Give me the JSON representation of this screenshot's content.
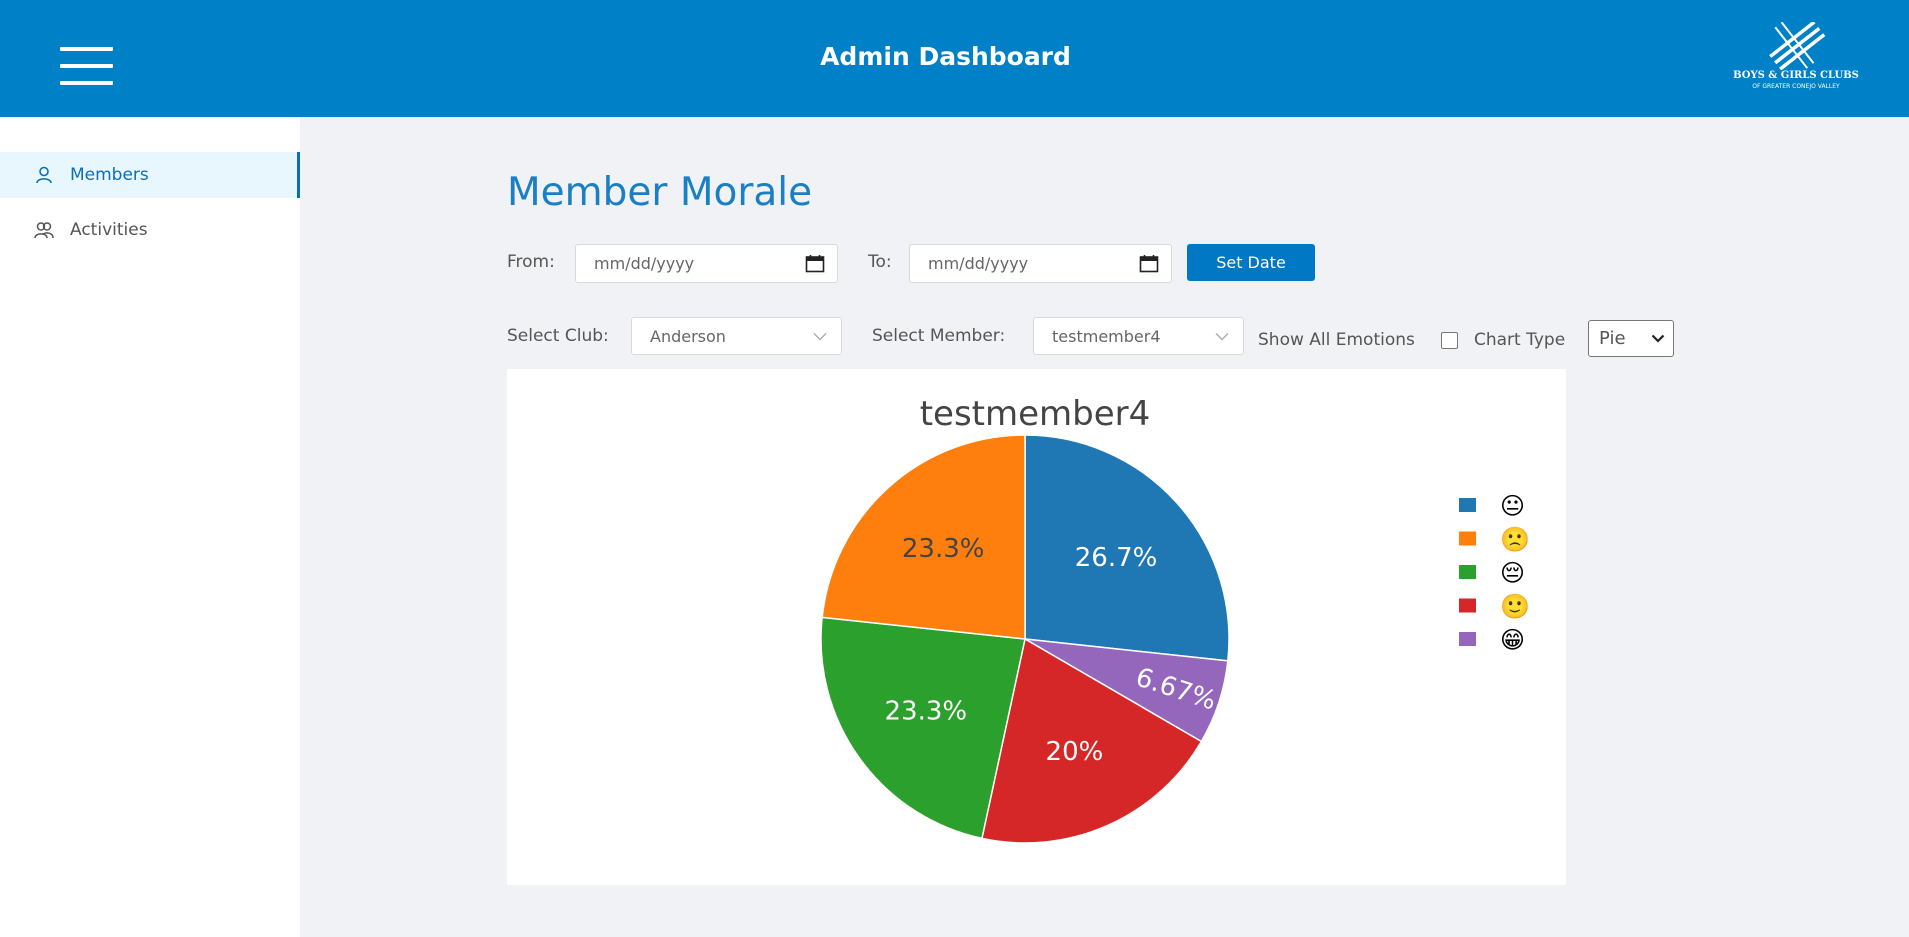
{
  "header": {
    "title": "Admin Dashboard",
    "logo_text": "BOYS & GIRLS CLUBS",
    "logo_subtext": "OF GREATER CONEJO VALLEY"
  },
  "sidebar": {
    "items": [
      {
        "label": "Members",
        "icon": "user-icon",
        "active": true
      },
      {
        "label": "Activities",
        "icon": "users-icon",
        "active": false
      }
    ]
  },
  "page": {
    "title": "Member Morale"
  },
  "filters": {
    "from_label": "From:",
    "from_placeholder": "mm/dd/yyyy",
    "to_label": "To:",
    "to_placeholder": "mm/dd/yyyy",
    "set_date_label": "Set Date",
    "club_label": "Select Club:",
    "club_value": "Anderson",
    "member_label": "Select Member:",
    "member_value": "testmember4",
    "show_all_label": "Show All Emotions",
    "show_all_checked": false,
    "chart_type_label": "Chart Type",
    "chart_type_value": "Pie"
  },
  "colors": {
    "header": "#0080c6",
    "accent": "#1a7fc4",
    "button": "#0078c4"
  },
  "chart_data": {
    "type": "pie",
    "title": "testmember4",
    "legend_position": "right",
    "slices": [
      {
        "emoji": "😐",
        "value": 26.7,
        "label": "26.7%",
        "color": "#1f77b4"
      },
      {
        "emoji": "😕",
        "value": 6.67,
        "label": "6.67%",
        "color": "#9467bd"
      },
      {
        "emoji": "🙂",
        "value": 20,
        "label": "20%",
        "color": "#d62728"
      },
      {
        "emoji": "😔",
        "value": 23.3,
        "label": "23.3%",
        "color": "#2ca02c"
      },
      {
        "emoji": "🙁",
        "value": 23.3,
        "label": "23.3%",
        "color": "#ff7f0e"
      }
    ],
    "legend": [
      {
        "emoji": "😐",
        "color": "#1f77b4"
      },
      {
        "emoji": "🙁",
        "color": "#ff7f0e"
      },
      {
        "emoji": "😔",
        "color": "#2ca02c"
      },
      {
        "emoji": "🙂",
        "color": "#d62728"
      },
      {
        "emoji": "😁",
        "color": "#9467bd"
      }
    ]
  }
}
